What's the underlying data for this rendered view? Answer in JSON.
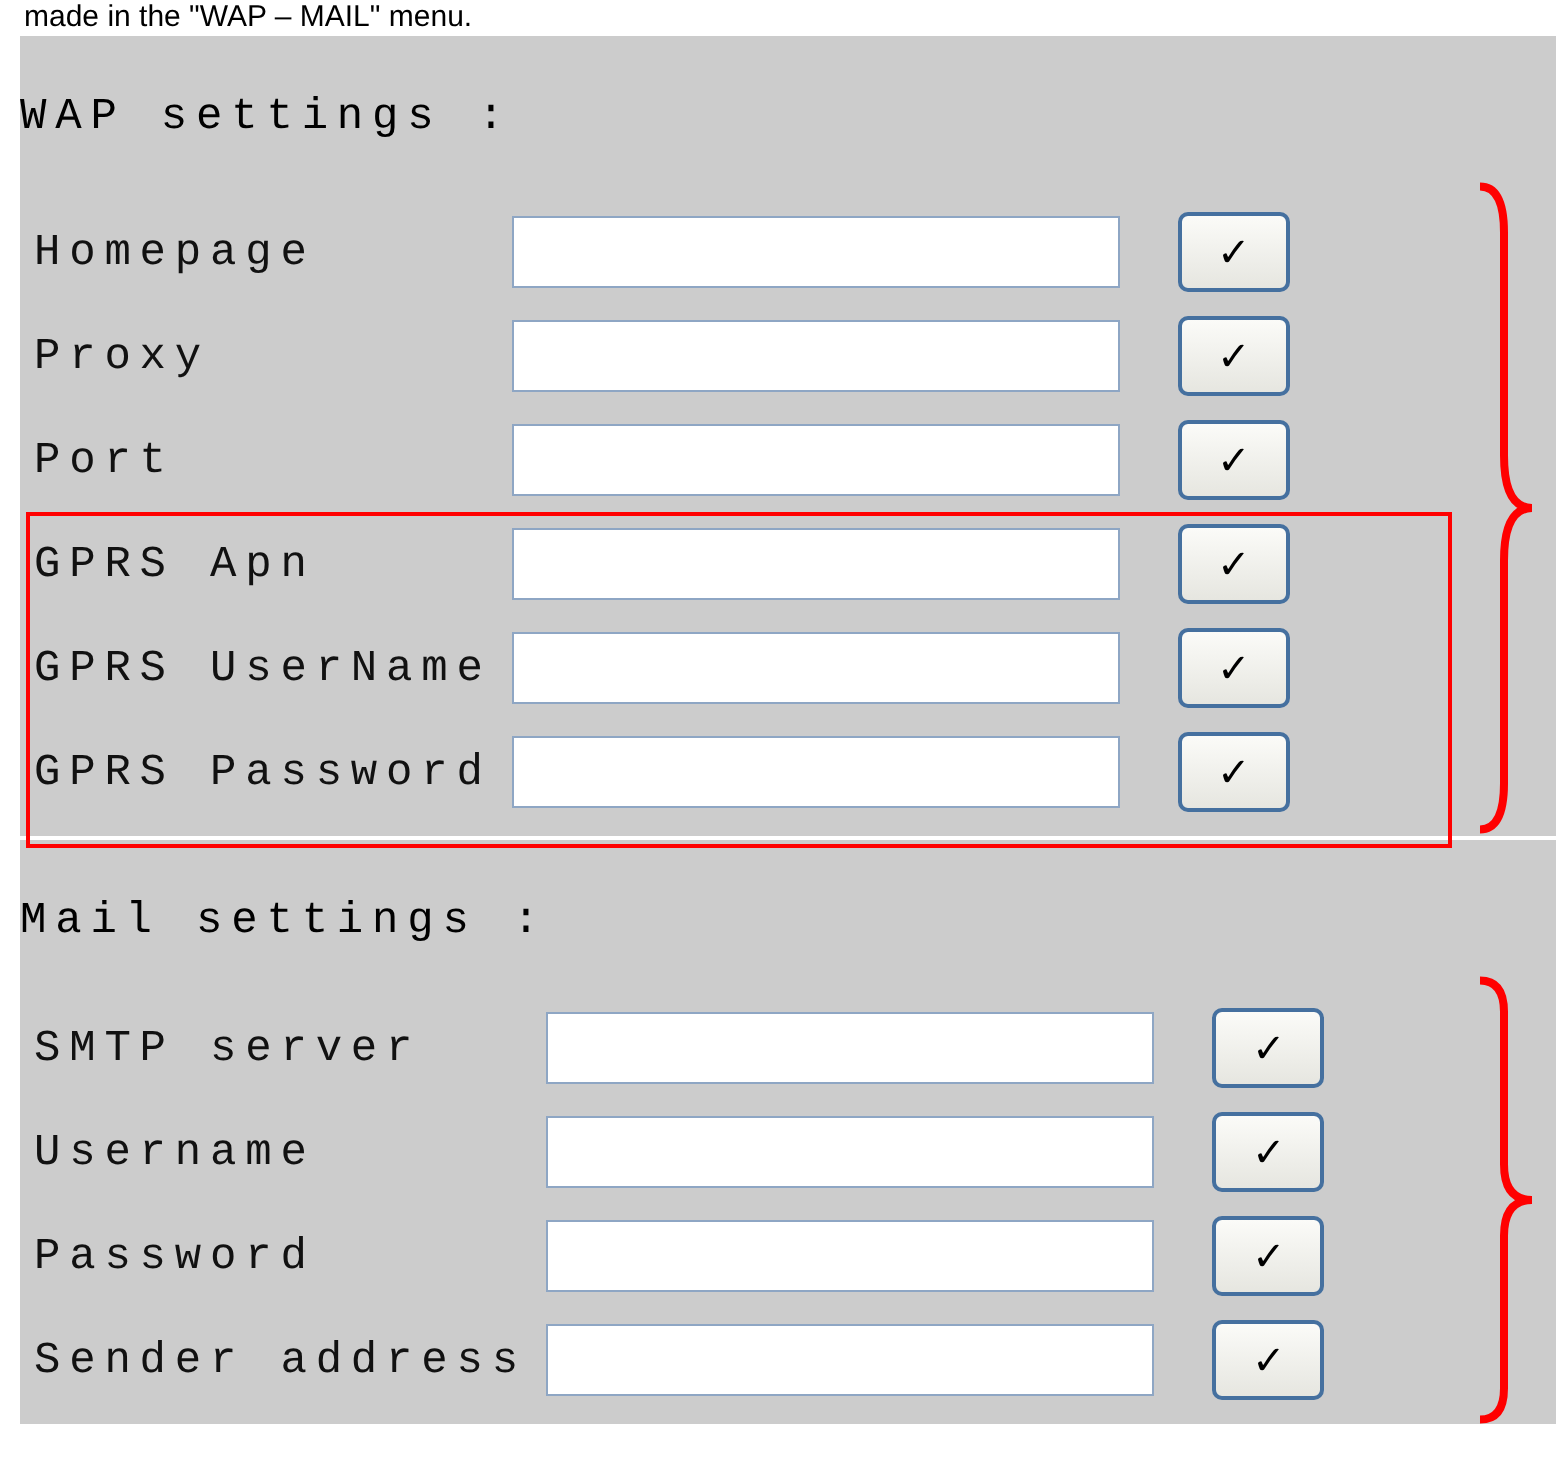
{
  "caption": "made in the \"WAP – MAIL\" menu.",
  "sections": [
    {
      "title": "WAP settings :",
      "bracketed": true,
      "fields": [
        {
          "label": "Homepage",
          "button": "✓",
          "highlighted": false
        },
        {
          "label": "Proxy",
          "button": "✓",
          "highlighted": false
        },
        {
          "label": "Port",
          "button": "✓",
          "highlighted": false
        },
        {
          "label": "GPRS Apn",
          "button": "✓",
          "highlighted": true
        },
        {
          "label": "GPRS UserName",
          "button": "✓",
          "highlighted": true
        },
        {
          "label": "GPRS Password",
          "button": "✓",
          "highlighted": true
        }
      ]
    },
    {
      "title": "Mail settings :",
      "bracketed": true,
      "fields": [
        {
          "label": "SMTP server",
          "button": "✓",
          "highlighted": false
        },
        {
          "label": "Username",
          "button": "✓",
          "highlighted": false
        },
        {
          "label": "Password",
          "button": "✓",
          "highlighted": false
        },
        {
          "label": "Sender address",
          "button": "✓",
          "highlighted": false
        }
      ]
    }
  ]
}
